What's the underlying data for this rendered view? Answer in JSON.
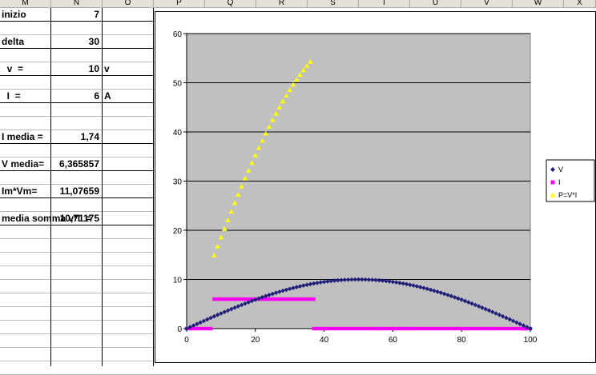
{
  "columns": [
    "M",
    "N",
    "O",
    "P",
    "Q",
    "R",
    "S",
    "T",
    "U",
    "V",
    "W",
    "X"
  ],
  "cells": [
    {
      "row": 0,
      "m": "inizio",
      "n": "7",
      "o": ""
    },
    {
      "row": 2,
      "m": "delta",
      "n": "30",
      "o": ""
    },
    {
      "row": 4,
      "m": "  v  =",
      "n": "10",
      "o": "v"
    },
    {
      "row": 6,
      "m": "  I  =",
      "n": "6",
      "o": "A"
    },
    {
      "row": 9,
      "m": "I media =",
      "n": "1,74",
      "o": ""
    },
    {
      "row": 11,
      "m": "V media=",
      "n": "6,365857",
      "o": ""
    },
    {
      "row": 13,
      "m": "Im*Vm=",
      "n": "11,07659",
      "o": ""
    },
    {
      "row": 15,
      "m": "media somma v*I  =",
      "n": "10,71175",
      "o": ""
    }
  ],
  "chart_data": {
    "type": "scatter",
    "xlim": [
      0,
      100
    ],
    "ylim": [
      0,
      60
    ],
    "x_ticks": [
      "0",
      "20",
      "40",
      "60",
      "80",
      "100"
    ],
    "y_ticks": [
      "0",
      "10",
      "20",
      "30",
      "40",
      "50",
      "60"
    ],
    "grid": "horizontal",
    "legend": "right",
    "series": [
      {
        "name": "V",
        "color": "#1f1f7a",
        "marker": "diamond",
        "x_start": 0,
        "x_end": 100,
        "x_step": 1,
        "peak": 10
      },
      {
        "name": "I",
        "color": "#ff00ff",
        "marker": "square",
        "segments": [
          {
            "x_start": 0,
            "x_end": 7,
            "value": 0
          },
          {
            "x_start": 8,
            "x_end": 37,
            "value": 6
          },
          {
            "x_start": 37,
            "x_end": 100,
            "value": 0
          }
        ]
      },
      {
        "name": "P=V*I",
        "color": "#ffff00",
        "marker": "triangle",
        "x_start": 7,
        "x_end": 36,
        "x_step": 1,
        "formula": "V*I"
      }
    ]
  }
}
